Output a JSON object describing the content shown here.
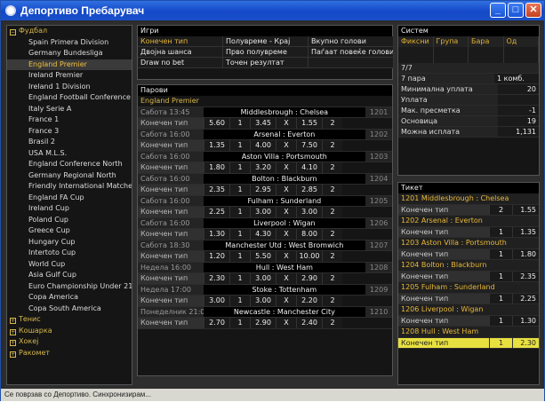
{
  "window": {
    "title": "Депортиво Пребарувач"
  },
  "status": "Се поврзав со Депортиво. Синхронизирам...",
  "tree": [
    {
      "type": "cat",
      "label": "Фудбал",
      "expanded": true
    },
    {
      "type": "sub",
      "label": "Spain Primera Division"
    },
    {
      "type": "sub",
      "label": "Germany Bundesliga"
    },
    {
      "type": "sub",
      "label": "England Premier",
      "selected": true
    },
    {
      "type": "sub",
      "label": "Ireland Premier"
    },
    {
      "type": "sub",
      "label": "Ireland 1 Division"
    },
    {
      "type": "sub",
      "label": "England Football Conference"
    },
    {
      "type": "sub",
      "label": "Italy Serie A"
    },
    {
      "type": "sub",
      "label": "France 1"
    },
    {
      "type": "sub",
      "label": "France 3"
    },
    {
      "type": "sub",
      "label": "Brasil 2"
    },
    {
      "type": "sub",
      "label": "USA M.L.S."
    },
    {
      "type": "sub",
      "label": "England Conference North"
    },
    {
      "type": "sub",
      "label": "Germany Regional North"
    },
    {
      "type": "sub",
      "label": "Friendly International Matches"
    },
    {
      "type": "sub",
      "label": "England FA Cup"
    },
    {
      "type": "sub",
      "label": "Ireland Cup"
    },
    {
      "type": "sub",
      "label": "Poland Cup"
    },
    {
      "type": "sub",
      "label": "Greece Cup"
    },
    {
      "type": "sub",
      "label": "Hungary Cup"
    },
    {
      "type": "sub",
      "label": "Intertoto Cup"
    },
    {
      "type": "sub",
      "label": "World Cup"
    },
    {
      "type": "sub",
      "label": "Asia Gulf Cup"
    },
    {
      "type": "sub",
      "label": "Euro Championship Under 21"
    },
    {
      "type": "sub",
      "label": "Copa America"
    },
    {
      "type": "sub",
      "label": "Copa South America"
    },
    {
      "type": "cat",
      "label": "Тенис",
      "expanded": false
    },
    {
      "type": "cat",
      "label": "Кошарка",
      "expanded": false
    },
    {
      "type": "cat",
      "label": "Хокеј",
      "expanded": false
    },
    {
      "type": "cat",
      "label": "Ракомет",
      "expanded": false
    }
  ],
  "games": {
    "header": "Игри",
    "items": [
      "Конечен тип",
      "Полувреме - Крај",
      "Вкупно голови",
      "Двојна шанса",
      "Прво полувреме",
      "Паѓаат повеќе голови",
      "Draw no bet",
      "Точен резултат",
      ""
    ]
  },
  "pairs": {
    "header": "Парови",
    "league": "England Premier",
    "matches": [
      {
        "time": "Сабота 13:45",
        "teams": "Middlesbrough : Chelsea",
        "code": "1201",
        "label": "Конечен тип",
        "odds": [
          "5.60",
          "1",
          "3.45",
          "X",
          "1.55",
          "2"
        ]
      },
      {
        "time": "Сабота 16:00",
        "teams": "Arsenal : Everton",
        "code": "1202",
        "label": "Конечен тип",
        "odds": [
          "1.35",
          "1",
          "4.00",
          "X",
          "7.50",
          "2"
        ]
      },
      {
        "time": "Сабота 16:00",
        "teams": "Aston Villa : Portsmouth",
        "code": "1203",
        "label": "Конечен тип",
        "odds": [
          "1.80",
          "1",
          "3.20",
          "X",
          "4.10",
          "2"
        ]
      },
      {
        "time": "Сабота 16:00",
        "teams": "Bolton : Blackburn",
        "code": "1204",
        "label": "Конечен тип",
        "odds": [
          "2.35",
          "1",
          "2.95",
          "X",
          "2.85",
          "2"
        ]
      },
      {
        "time": "Сабота 16:00",
        "teams": "Fulham : Sunderland",
        "code": "1205",
        "label": "Конечен тип",
        "odds": [
          "2.25",
          "1",
          "3.00",
          "X",
          "3.00",
          "2"
        ]
      },
      {
        "time": "Сабота 16:00",
        "teams": "Liverpool : Wigan",
        "code": "1206",
        "label": "Конечен тип",
        "odds": [
          "1.30",
          "1",
          "4.30",
          "X",
          "8.00",
          "2"
        ]
      },
      {
        "time": "Сабота 18:30",
        "teams": "Manchester Utd : West Bromwich",
        "code": "1207",
        "label": "Конечен тип",
        "odds": [
          "1.20",
          "1",
          "5.50",
          "X",
          "10.00",
          "2"
        ]
      },
      {
        "time": "Недела 16:00",
        "teams": "Hull : West Ham",
        "code": "1208",
        "label": "Конечен тип",
        "odds": [
          "2.30",
          "1",
          "3.00",
          "X",
          "2.90",
          "2"
        ]
      },
      {
        "time": "Недела 17:00",
        "teams": "Stoke : Tottenham",
        "code": "1209",
        "label": "Конечен тип",
        "odds": [
          "3.00",
          "1",
          "3.00",
          "X",
          "2.20",
          "2"
        ]
      },
      {
        "time": "Понеделник 21:00",
        "teams": "Newcastle : Manchester City",
        "code": "1210",
        "label": "Конечен тип",
        "odds": [
          "2.70",
          "1",
          "2.90",
          "X",
          "2.40",
          "2"
        ]
      }
    ]
  },
  "system": {
    "header": "Систем",
    "tabs": [
      "Фиксни",
      "Група",
      "Бара",
      "Од"
    ],
    "fraction": "7/7",
    "pairs_label": "7 пара",
    "combo": "1 комб.",
    "rows": [
      {
        "k": "Минимална уплата",
        "v": "20"
      },
      {
        "k": "Уплата",
        "v": ""
      },
      {
        "k": "Мак. пресметка",
        "v": "-1"
      },
      {
        "k": "Основица",
        "v": "19"
      },
      {
        "k": "Можна исплата",
        "v": "1,131"
      }
    ]
  },
  "ticket": {
    "header": "Тикет",
    "items": [
      {
        "match": "1201 Middlesbrough : Chelsea",
        "label": "Конечен тип",
        "sel": "2",
        "odd": "1.55"
      },
      {
        "match": "1202 Arsenal : Everton",
        "label": "Конечен тип",
        "sel": "1",
        "odd": "1.35"
      },
      {
        "match": "1203 Aston Villa : Portsmouth",
        "label": "Конечен тип",
        "sel": "1",
        "odd": "1.80"
      },
      {
        "match": "1204 Bolton : Blackburn",
        "label": "Конечен тип",
        "sel": "1",
        "odd": "2.35"
      },
      {
        "match": "1205 Fulham : Sunderland",
        "label": "Конечен тип",
        "sel": "1",
        "odd": "2.25"
      },
      {
        "match": "1206 Liverpool : Wigan",
        "label": "Конечен тип",
        "sel": "1",
        "odd": "1.30"
      },
      {
        "match": "1208 Hull : West Ham",
        "label": "Конечен тип",
        "sel": "1",
        "odd": "2.30",
        "highlight": true
      }
    ]
  }
}
